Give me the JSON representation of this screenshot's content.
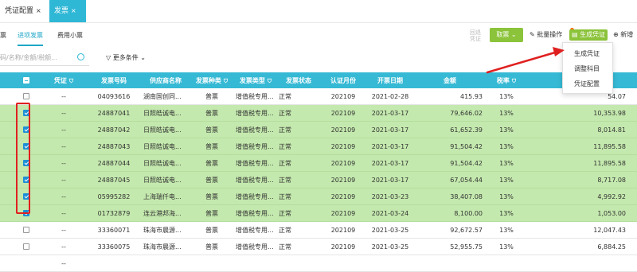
{
  "tabs": [
    {
      "label": "凭证配置",
      "close": "×"
    },
    {
      "label": "发票",
      "close": "×"
    }
  ],
  "subtabs": [
    {
      "label": "票"
    },
    {
      "label": "进项发票"
    },
    {
      "label": "费用小票"
    }
  ],
  "search": {
    "placeholder": "码/名称/金额/税额..."
  },
  "filter": {
    "more_label": "更多条件"
  },
  "toolbar": {
    "ghost_label": "回退\n凭证",
    "main_label": "取票",
    "batch_label": "批量操作",
    "generate_label": "生成凭证",
    "new_label": "新增"
  },
  "dropdown": {
    "items": [
      "生成凭证",
      "调整科目",
      "凭证配置"
    ]
  },
  "table": {
    "columns": [
      "凭证",
      "发票号码",
      "供应商名称",
      "发票种类",
      "发票类型",
      "发票状态",
      "认证月份",
      "开票日期",
      "金额",
      "税率",
      "税额"
    ],
    "rows": [
      {
        "selected": false,
        "voucher": "--",
        "invoice_no": "04093616",
        "supplier": "湖南国创同...",
        "kind": "普票",
        "type": "增值税专用...",
        "status": "正常",
        "month": "202109",
        "date": "2021-02-28",
        "amount": "415.93",
        "rate": "13%",
        "tax": "54.07"
      },
      {
        "selected": true,
        "voucher": "--",
        "invoice_no": "24887041",
        "supplier": "日照皓诚电...",
        "kind": "普票",
        "type": "增值税专用...",
        "status": "正常",
        "month": "202109",
        "date": "2021-03-17",
        "amount": "79,646.02",
        "rate": "13%",
        "tax": "10,353.98"
      },
      {
        "selected": true,
        "voucher": "--",
        "invoice_no": "24887042",
        "supplier": "日照皓诚电...",
        "kind": "普票",
        "type": "增值税专用...",
        "status": "正常",
        "month": "202109",
        "date": "2021-03-17",
        "amount": "61,652.39",
        "rate": "13%",
        "tax": "8,014.81"
      },
      {
        "selected": true,
        "voucher": "--",
        "invoice_no": "24887043",
        "supplier": "日照皓诚电...",
        "kind": "普票",
        "type": "增值税专用...",
        "status": "正常",
        "month": "202109",
        "date": "2021-03-17",
        "amount": "91,504.42",
        "rate": "13%",
        "tax": "11,895.58"
      },
      {
        "selected": true,
        "voucher": "--",
        "invoice_no": "24887044",
        "supplier": "日照皓诚电...",
        "kind": "普票",
        "type": "增值税专用...",
        "status": "正常",
        "month": "202109",
        "date": "2021-03-17",
        "amount": "91,504.42",
        "rate": "13%",
        "tax": "11,895.58"
      },
      {
        "selected": true,
        "voucher": "--",
        "invoice_no": "24887045",
        "supplier": "日照皓诚电...",
        "kind": "普票",
        "type": "增值税专用...",
        "status": "正常",
        "month": "202109",
        "date": "2021-03-17",
        "amount": "67,054.44",
        "rate": "13%",
        "tax": "8,717.08"
      },
      {
        "selected": true,
        "voucher": "--",
        "invoice_no": "05995282",
        "supplier": "上海瑞仟电...",
        "kind": "普票",
        "type": "增值税专用...",
        "status": "正常",
        "month": "202109",
        "date": "2021-03-23",
        "amount": "38,407.08",
        "rate": "13%",
        "tax": "4,992.92"
      },
      {
        "selected": true,
        "voucher": "--",
        "invoice_no": "01732879",
        "supplier": "连云港邦海...",
        "kind": "普票",
        "type": "增值税专用...",
        "status": "正常",
        "month": "202109",
        "date": "2021-03-24",
        "amount": "8,100.00",
        "rate": "13%",
        "tax": "1,053.00"
      },
      {
        "selected": false,
        "voucher": "--",
        "invoice_no": "33360071",
        "supplier": "珠海市晨源...",
        "kind": "普票",
        "type": "增值税专用...",
        "status": "正常",
        "month": "202109",
        "date": "2021-03-25",
        "amount": "92,672.57",
        "rate": "13%",
        "tax": "12,047.43"
      },
      {
        "selected": false,
        "voucher": "--",
        "invoice_no": "33360075",
        "supplier": "珠海市晨源...",
        "kind": "普票",
        "type": "增值税专用...",
        "status": "正常",
        "month": "202109",
        "date": "2021-03-25",
        "amount": "52,955.75",
        "rate": "13%",
        "tax": "6,884.25"
      },
      {
        "selected": false,
        "voucher": "--",
        "invoice_no": "",
        "supplier": "",
        "kind": "",
        "type": "",
        "status": "",
        "month": "",
        "date": "",
        "amount": "",
        "rate": "",
        "tax": ""
      }
    ]
  },
  "colors": {
    "header": "#36b9d4",
    "selected_row": "#c4e9ae",
    "accent_green": "#8bc33a",
    "annotation_red": "#e02020"
  }
}
